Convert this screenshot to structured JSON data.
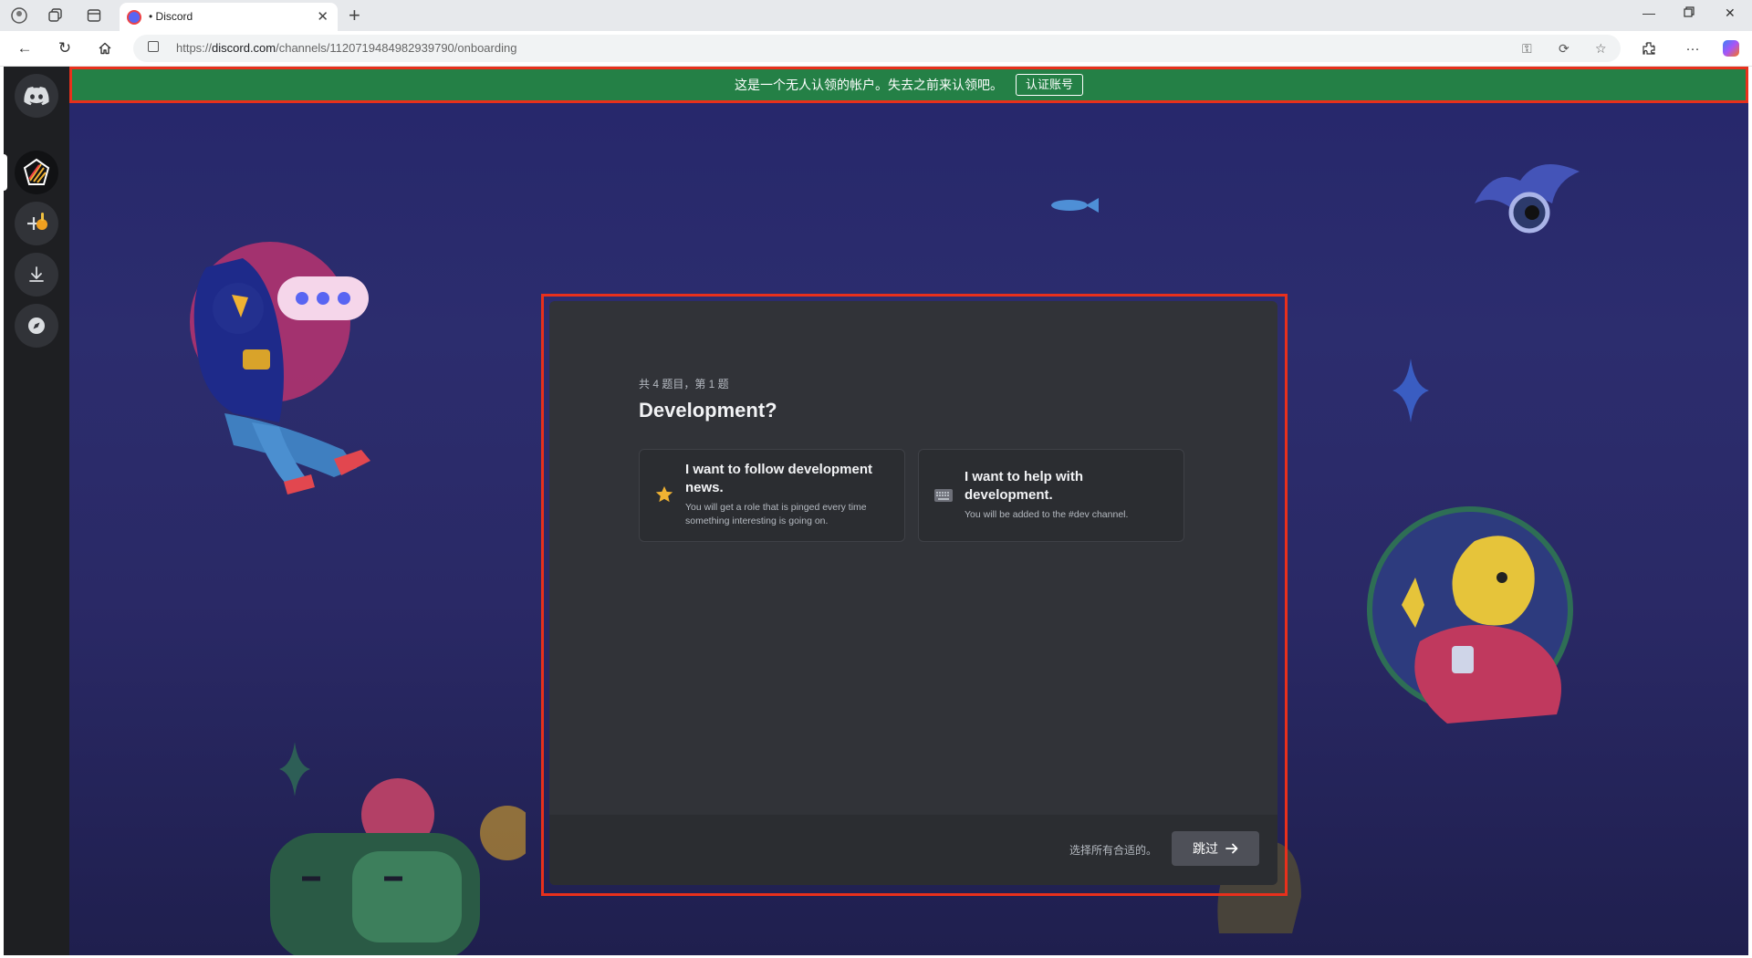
{
  "browser": {
    "tab": {
      "title": "• Discord"
    },
    "address": {
      "prefix": "https://",
      "host": "discord.com",
      "path": "/channels/1120719484982939790/onboarding"
    }
  },
  "banner": {
    "text": "这是一个无人认领的帐户。失去之前来认领吧。",
    "button": "认证账号",
    "color": "#248046"
  },
  "onboarding": {
    "counter": "共 4 题目，第 1 题",
    "question": "Development?",
    "options": [
      {
        "icon": "star-icon",
        "title": "I want to follow development news.",
        "description": "You will get a role that is pinged every time something interesting is going on."
      },
      {
        "icon": "keyboard-icon",
        "title": "I want to help with development.",
        "description": "You will be added to the #dev channel."
      }
    ],
    "footer_hint": "选择所有合适的。",
    "skip_label": "跳过"
  },
  "colors": {
    "accent": "#5865f2",
    "modal_bg": "#313338",
    "highlight_outline": "#e8301c"
  }
}
